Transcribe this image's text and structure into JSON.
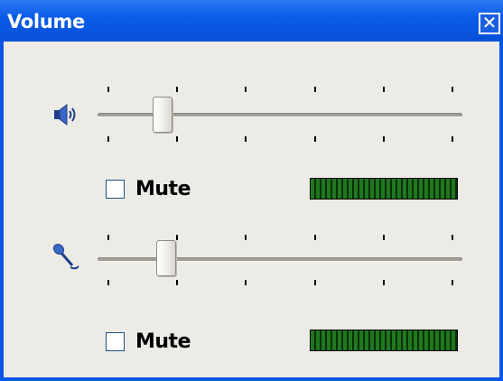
{
  "window": {
    "title": "Volume",
    "close_label": "✕"
  },
  "speaker": {
    "icon": "speaker-icon",
    "level": 0.16,
    "mute_label": "Mute",
    "muted": false,
    "meter_level": 1.0
  },
  "microphone": {
    "icon": "microphone-icon",
    "level": 0.17,
    "mute_label": "Mute",
    "muted": false,
    "meter_level": 1.0
  },
  "colors": {
    "titlebar": "#0a5ce8",
    "client": "#ecebe6",
    "meter_on": "#20781e"
  }
}
